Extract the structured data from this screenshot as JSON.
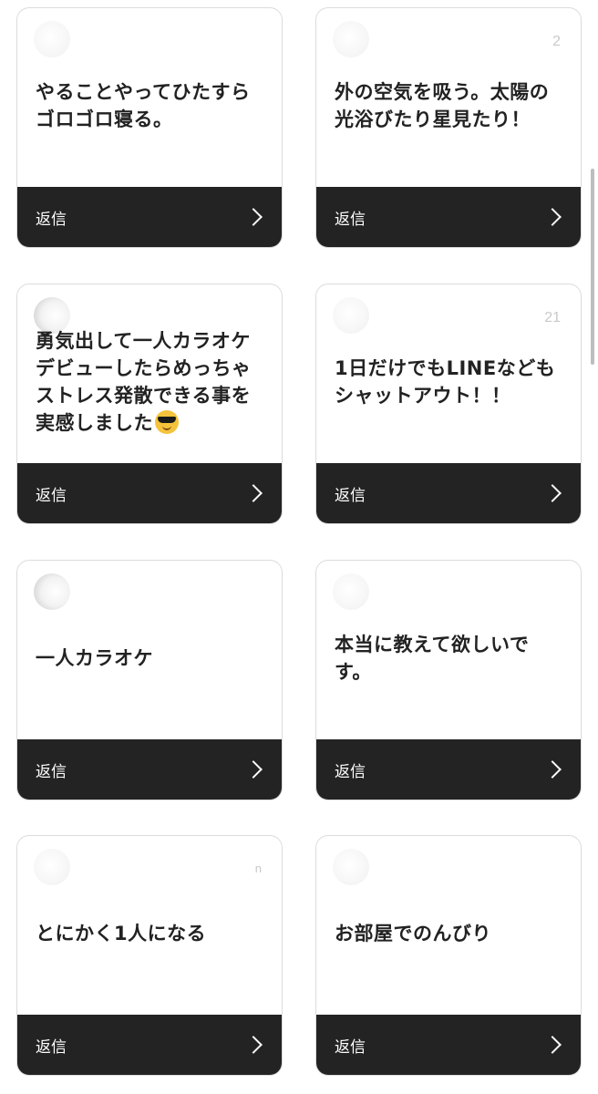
{
  "cards": [
    {
      "message": "やることやってひたすらゴロゴロ寝る。",
      "corner": "",
      "reply_label": "返信"
    },
    {
      "message": "外の空気を吸う。太陽の光浴びたり星見たり！",
      "corner": "2",
      "reply_label": "返信"
    },
    {
      "message": "勇気出して一人カラオケデビューしたらめっちゃストレス発散できる事を実感しました",
      "emoji": "smiling-face-with-sunglasses",
      "corner": "",
      "reply_label": "返信"
    },
    {
      "message": "1日だけでもLINEなどもシャットアウト！！",
      "corner": "21",
      "reply_label": "返信"
    },
    {
      "message": "一人カラオケ",
      "corner": "",
      "reply_label": "返信"
    },
    {
      "message": "本当に教えて欲しいです。",
      "corner": "",
      "reply_label": "返信"
    },
    {
      "message": "とにかく1人になる",
      "corner": "n",
      "reply_label": "返信"
    },
    {
      "message": "お部屋でのんびり",
      "corner": "",
      "reply_label": "返信"
    }
  ],
  "colors": {
    "reply_bar": "#232323",
    "card_border": "#dcdcdc",
    "text": "#222222"
  }
}
